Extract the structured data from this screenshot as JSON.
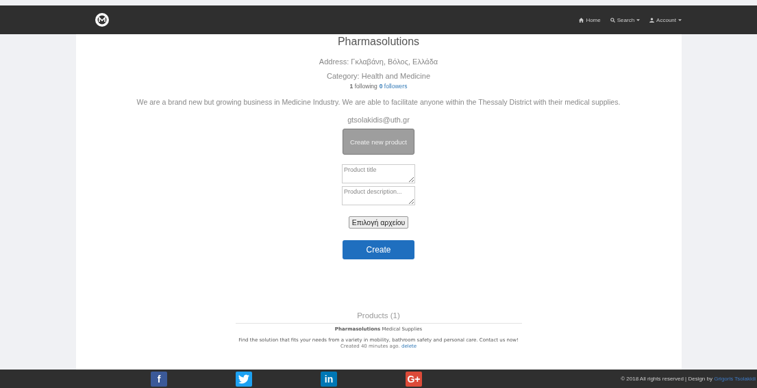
{
  "navbar": {
    "links": [
      {
        "kind": "home",
        "label": "Home",
        "dropdown": false
      },
      {
        "kind": "search",
        "label": "Search",
        "dropdown": true
      },
      {
        "kind": "account",
        "label": "Account",
        "dropdown": true
      }
    ]
  },
  "business": {
    "name": "Pharmasolutions",
    "address": "Address: Γκλαβάνη, Βόλος, Ελλάδα",
    "category": "Category: Health and Medicine",
    "following_count": "1",
    "following_label": "following",
    "followers_count": "0",
    "followers_label": "followers",
    "description": "We are a brand new but growing business in Medicine Industry. We are able to facilitate anyone within the Thessaly District with their medical supplies.",
    "email": "gtsolakidis@uth.gr"
  },
  "form": {
    "toggle_button": "Create new product",
    "title_placeholder": "Product title",
    "description_placeholder": "Product description...",
    "file_button": "Επιλογή αρχείου",
    "submit_button": "Create"
  },
  "products": {
    "heading": "Products (1)",
    "items": [
      {
        "owner": "Pharmasolutions",
        "title": "Medical Supplies",
        "description": "Find the solution that fits your needs from a variety in mobility, bathroom safety and personal care. Contact us now!",
        "created": "Created 40 minutes ago.",
        "delete_label": "delete"
      }
    ]
  },
  "footer": {
    "social": [
      {
        "kind": "facebook",
        "glyph": "f"
      },
      {
        "kind": "twitter"
      },
      {
        "kind": "linkedin",
        "glyph": "in"
      },
      {
        "kind": "googleplus",
        "glyph": "G+"
      }
    ],
    "copyright": "© 2018 All rights reserved | Design by",
    "designer": "Grigoris Tsolakidi"
  }
}
